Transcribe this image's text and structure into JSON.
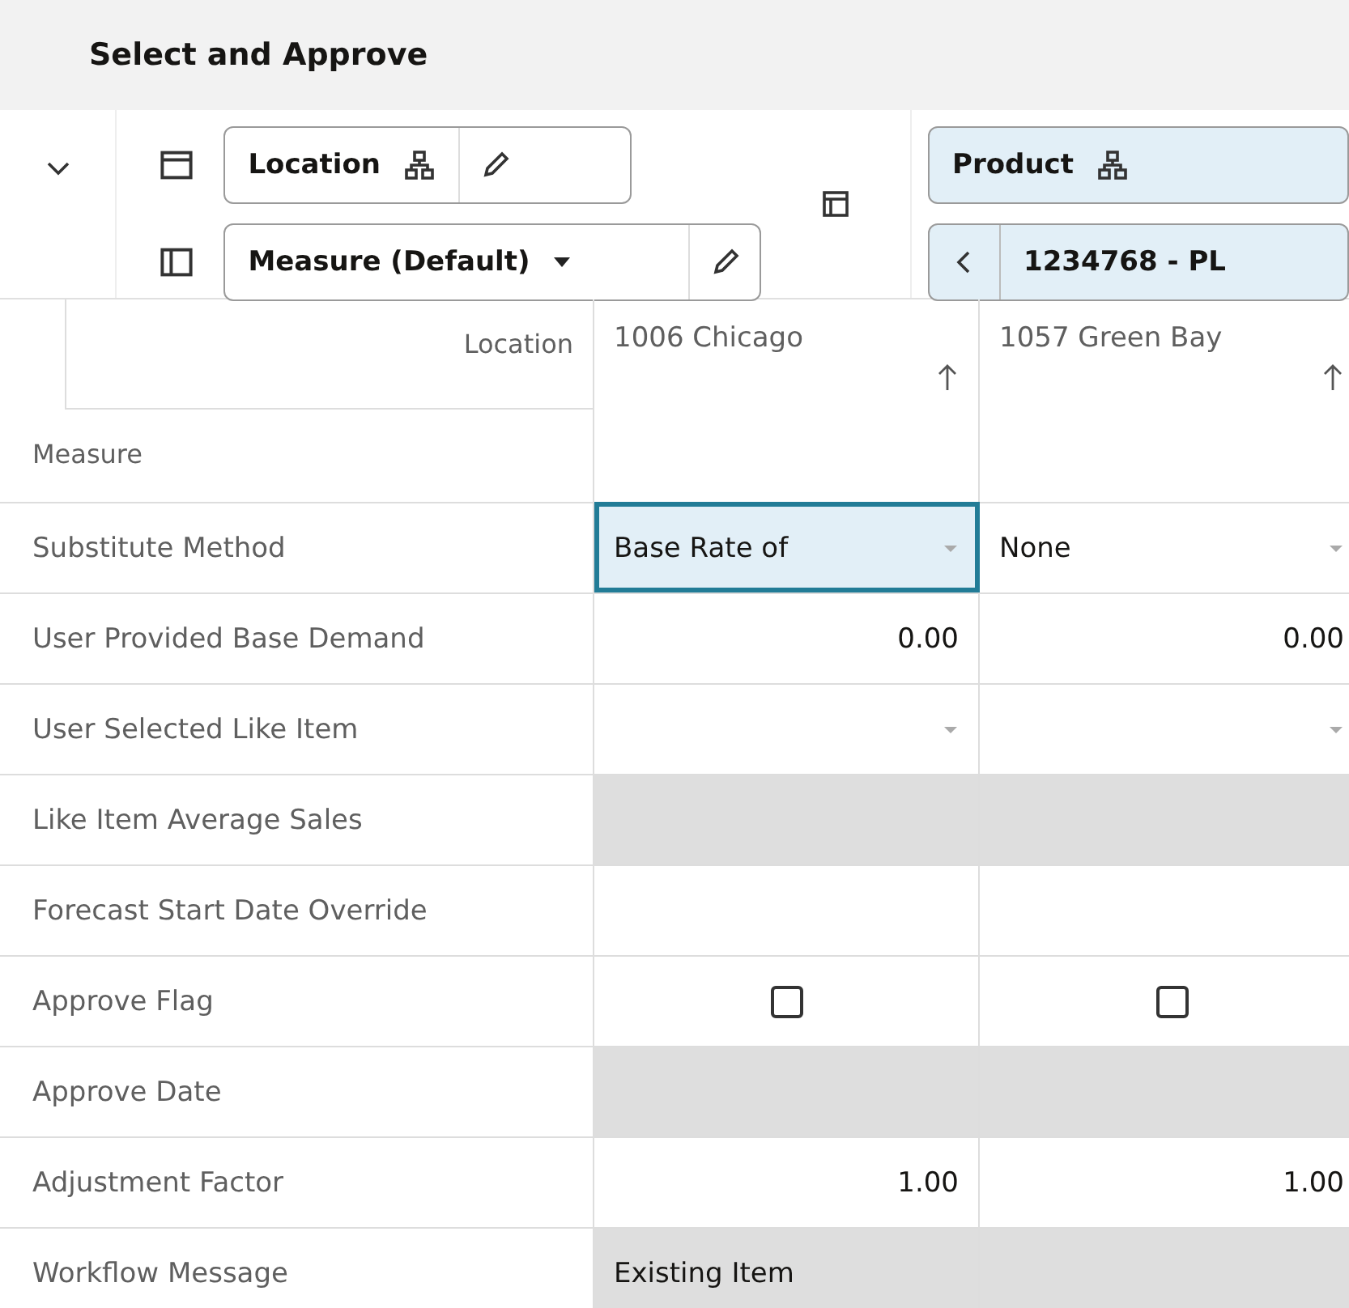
{
  "title": "Select and Approve",
  "toolbar": {
    "row_pivot": {
      "label": "Location"
    },
    "column_pivot": {
      "label": "Measure (Default)"
    },
    "page_pivot": {
      "label": "Product"
    },
    "page_member": {
      "label": "1234768 - PL"
    }
  },
  "header": {
    "row_axis": "Location",
    "column_axis": "Measure"
  },
  "columns": [
    {
      "label": "1006 Chicago"
    },
    {
      "label": "1057 Green Bay"
    }
  ],
  "rows": [
    {
      "label": "Substitute Method",
      "cells": [
        {
          "kind": "dropdown",
          "value": "Base Rate of",
          "focused": true
        },
        {
          "kind": "dropdown",
          "value": "None",
          "focused": false
        }
      ]
    },
    {
      "label": "User Provided Base Demand",
      "cells": [
        {
          "kind": "number",
          "value": "0.00"
        },
        {
          "kind": "number",
          "value": "0.00"
        }
      ]
    },
    {
      "label": "User Selected Like Item",
      "cells": [
        {
          "kind": "dropdown",
          "focused": false
        },
        {
          "kind": "dropdown",
          "focused": false
        }
      ]
    },
    {
      "label": "Like Item Average Sales",
      "cells": [
        {
          "kind": "readonly"
        },
        {
          "kind": "readonly"
        }
      ]
    },
    {
      "label": "Forecast Start Date Override",
      "cells": [
        {
          "kind": "empty"
        },
        {
          "kind": "empty"
        }
      ]
    },
    {
      "label": "Approve Flag",
      "cells": [
        {
          "kind": "checkbox",
          "checked": false
        },
        {
          "kind": "checkbox",
          "checked": false
        }
      ]
    },
    {
      "label": "Approve Date",
      "cells": [
        {
          "kind": "readonly"
        },
        {
          "kind": "readonly"
        }
      ]
    },
    {
      "label": "Adjustment Factor",
      "cells": [
        {
          "kind": "number",
          "value": "1.00"
        },
        {
          "kind": "number",
          "value": "1.00"
        }
      ]
    },
    {
      "label": "Workflow Message",
      "cells": [
        {
          "kind": "readonly",
          "value": "Existing Item"
        },
        {
          "kind": "readonly"
        }
      ]
    }
  ]
}
